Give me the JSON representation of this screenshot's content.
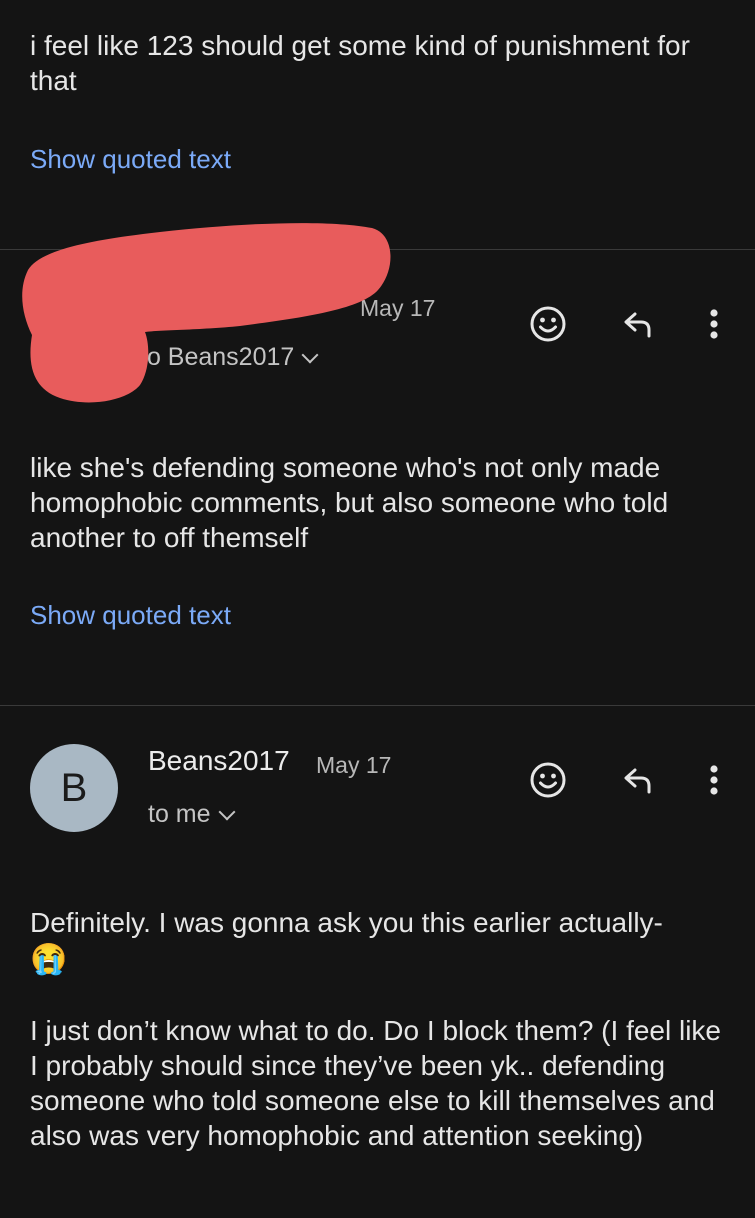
{
  "message1": {
    "body": "i feel like 123 should get some kind of punishment for that",
    "show_quoted": "Show quoted text"
  },
  "message2": {
    "date": "May 17",
    "recipient": "to Beans2017",
    "body": "like she's defending someone who's not only made homophobic comments, but also someone who told another to off themself",
    "show_quoted": "Show quoted text",
    "redaction_color": "#e85c5c"
  },
  "message3": {
    "avatar_letter": "B",
    "sender": "Beans2017",
    "date": "May 17",
    "recipient": "to me",
    "body_line1": "Definitely. I was gonna ask you this earlier actually-",
    "emoji": "😭",
    "body_para2": "I just don’t know what to do. Do I block them? (I feel like I probably should since they’ve been yk.. defending someone who told someone else to kill themselves and also was very homophobic and attention seeking)",
    "avatar_color": "#a9b8c4"
  },
  "icons": {
    "react": "emoji-smile-icon",
    "reply": "reply-arrow-icon",
    "more": "more-vert-icon"
  },
  "colors": {
    "background": "#141414",
    "link": "#7baaf7",
    "text": "#e6e6e6"
  }
}
